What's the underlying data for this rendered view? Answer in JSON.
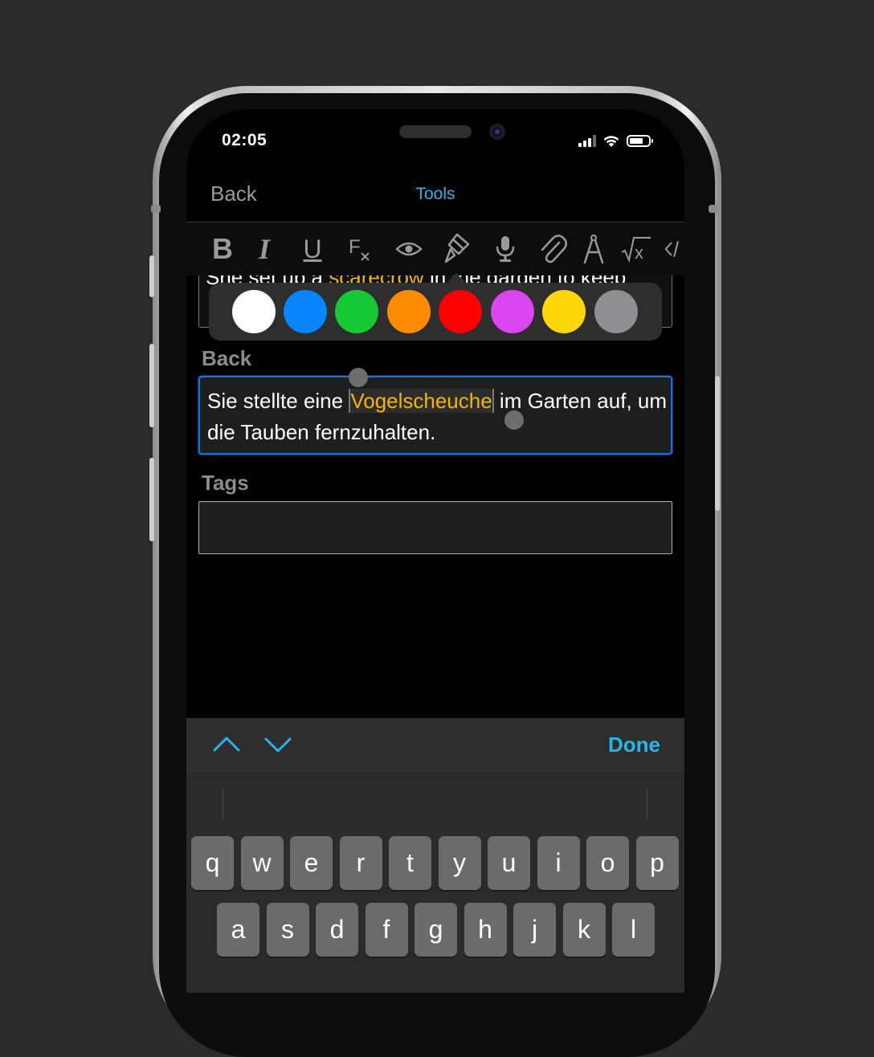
{
  "status_bar": {
    "time": "02:05",
    "icons": [
      "cellular-signal-icon",
      "wifi-icon",
      "battery-icon"
    ]
  },
  "nav": {
    "back_label": "Back",
    "title": "Tools"
  },
  "toolbar": {
    "tools": [
      {
        "name": "bold",
        "glyph": "B"
      },
      {
        "name": "italic",
        "glyph": "I"
      },
      {
        "name": "underline",
        "glyph": "U"
      },
      {
        "name": "clear-format",
        "glyph": "F"
      },
      {
        "name": "preview-eye",
        "glyph": ""
      },
      {
        "name": "brush-color",
        "glyph": ""
      },
      {
        "name": "microphone",
        "glyph": ""
      },
      {
        "name": "attachment",
        "glyph": ""
      },
      {
        "name": "drawing-compass",
        "glyph": ""
      },
      {
        "name": "math-sqrt",
        "glyph": "x"
      },
      {
        "name": "html-code",
        "glyph": ""
      }
    ]
  },
  "front": {
    "text_before": "She set up a ",
    "highlight": "scarecrow",
    "text_after": " in the garden to keep"
  },
  "palette": {
    "colors": [
      "#ffffff",
      "#0a84ff",
      "#18c937",
      "#ff8c00",
      "#ff0000",
      "#d946ef",
      "#ffd60a",
      "#8e8e93"
    ]
  },
  "back": {
    "label": "Back",
    "text_before": "Sie stellte eine ",
    "selected": "Vogelscheuche",
    "text_after": " im Garten auf, um die Tauben fernzuhalten."
  },
  "tags": {
    "label": "Tags",
    "value": ""
  },
  "accessory": {
    "done_label": "Done"
  },
  "keyboard": {
    "row1": [
      "q",
      "w",
      "e",
      "r",
      "t",
      "y",
      "u",
      "i",
      "o",
      "p"
    ],
    "row2": [
      "a",
      "s",
      "d",
      "f",
      "g",
      "h",
      "j",
      "k",
      "l"
    ]
  }
}
